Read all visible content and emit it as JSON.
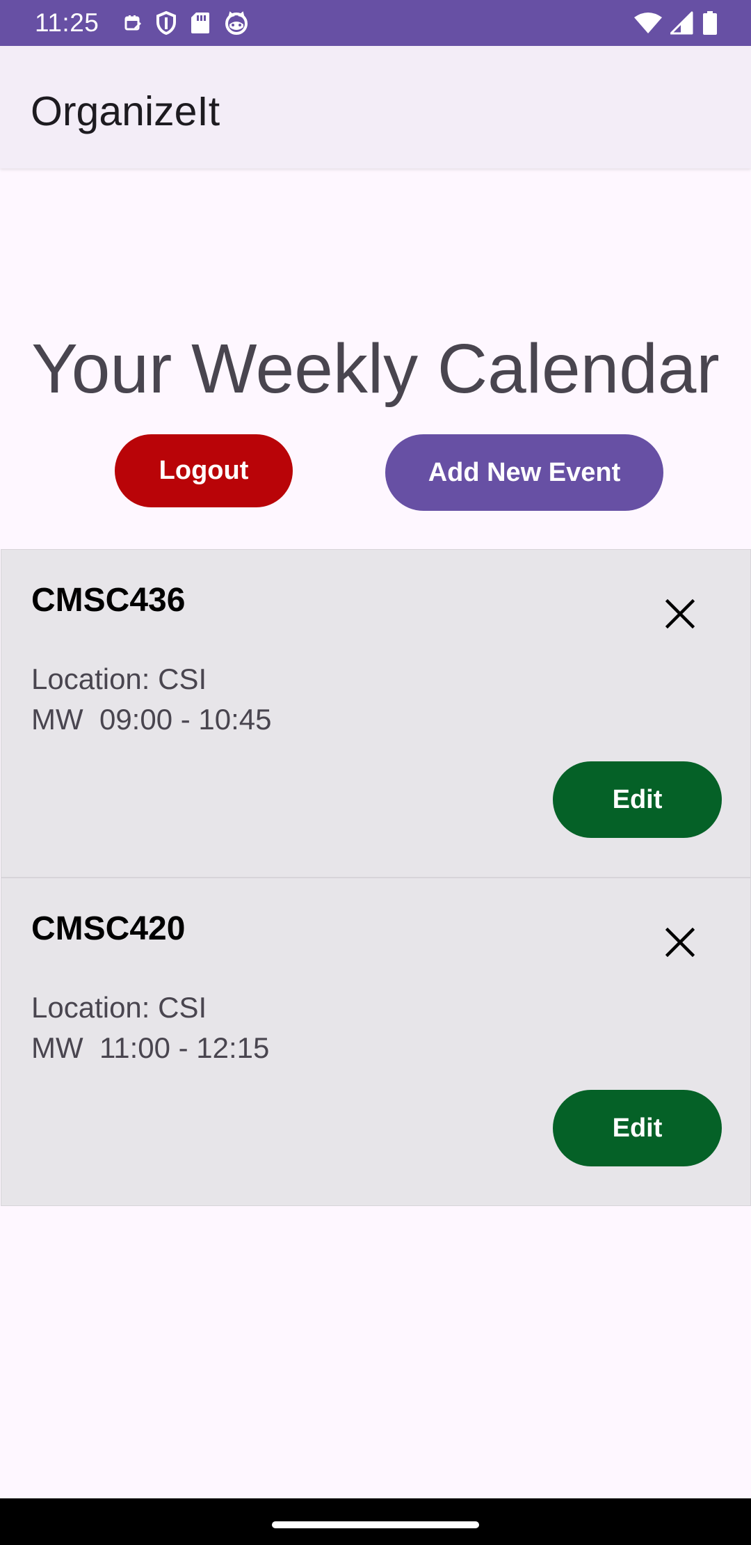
{
  "status_bar": {
    "time": "11:25",
    "left_icons": [
      "calendar-icon",
      "shield-icon",
      "sd-card-icon",
      "cat-face-icon"
    ],
    "right_icons": [
      "wifi-icon",
      "signal-icon",
      "battery-icon"
    ],
    "color": "#6750a4"
  },
  "app_bar": {
    "title": "OrganizeIt"
  },
  "main": {
    "heading": "Your Weekly Calendar",
    "logout_label": "Logout",
    "add_event_label": "Add New Event"
  },
  "events": [
    {
      "title": "CMSC436",
      "location": "Location: CSI",
      "time": "MW  09:00 - 10:45",
      "edit_label": "Edit"
    },
    {
      "title": "CMSC420",
      "location": "Location: CSI",
      "time": "MW  11:00 - 12:15",
      "edit_label": "Edit"
    }
  ],
  "colors": {
    "primary": "#6750a4",
    "logout": "#b90408",
    "edit": "#056127",
    "background": "#fef7ff",
    "card": "#e7e5e9"
  }
}
